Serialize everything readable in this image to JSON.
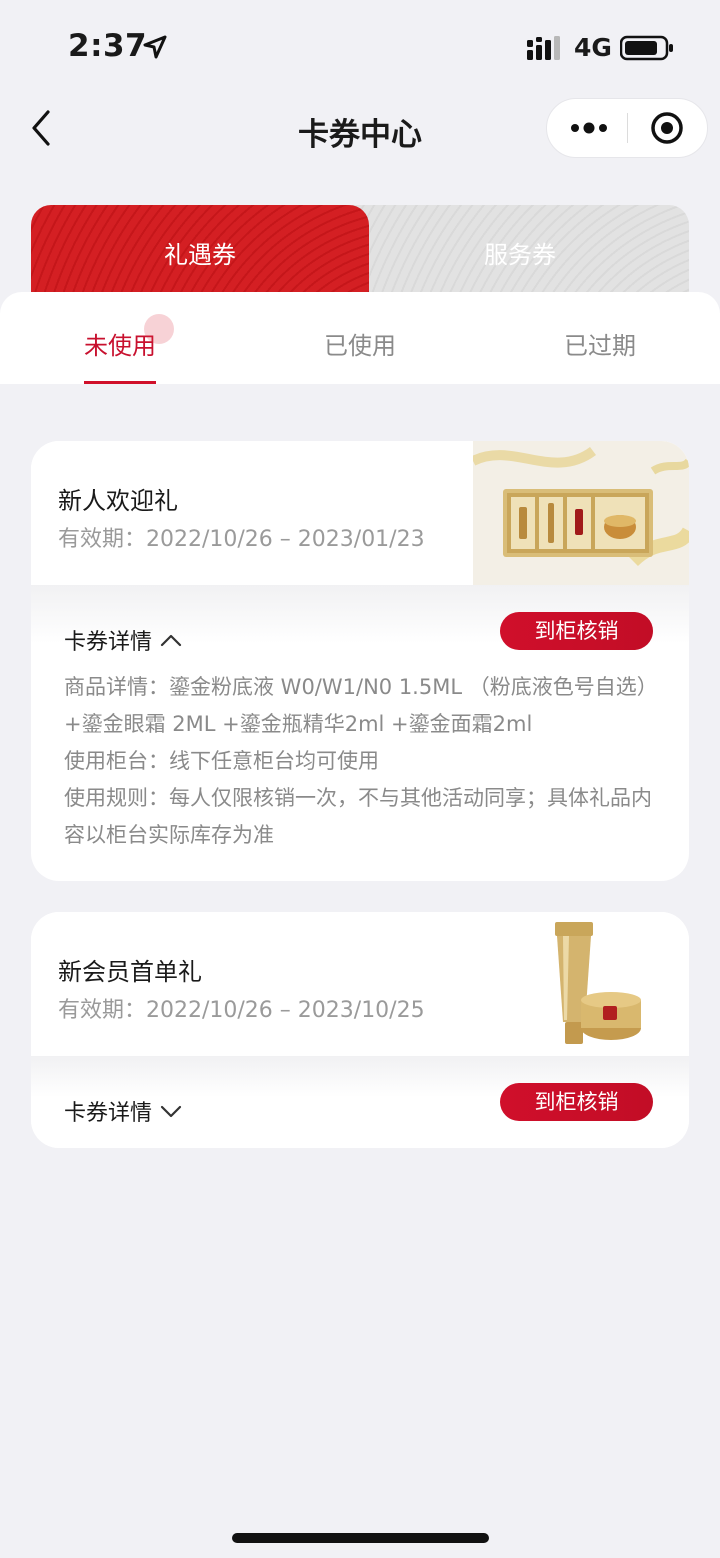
{
  "status_bar": {
    "time": "2:37",
    "network": "4G"
  },
  "nav": {
    "title": "卡券中心"
  },
  "main_tabs": [
    {
      "label": "礼遇券"
    },
    {
      "label": "服务券"
    }
  ],
  "sub_tabs": [
    {
      "label": "未使用"
    },
    {
      "label": "已使用"
    },
    {
      "label": "已过期"
    }
  ],
  "coupons": [
    {
      "title": "新人欢迎礼",
      "validity": "有效期：2022/10/26 – 2023/01/23",
      "details_label": "卡券详情",
      "redeem_label": "到柜核销",
      "expanded": true,
      "details": [
        "商品详情：鎏金粉底液 W0/W1/N0 1.5ML （粉底液色号自选）+鎏金眼霜 2ML +鎏金瓶精华2ml +鎏金面霜2ml",
        "使用柜台：线下任意柜台均可使用",
        "使用规则：每人仅限核销一次，不与其他活动同享；具体礼品内容以柜台实际库存为准"
      ]
    },
    {
      "title": "新会员首单礼",
      "validity": "有效期：2022/10/26 – 2023/10/25",
      "details_label": "卡券详情",
      "redeem_label": "到柜核销",
      "expanded": false
    }
  ],
  "colors": {
    "accent": "#c8102e",
    "tab_red": "#d41f23",
    "background": "#f1f1f5"
  }
}
